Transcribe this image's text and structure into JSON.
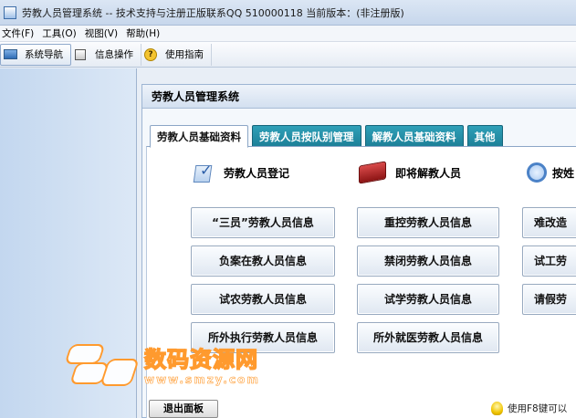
{
  "window": {
    "title": "劳教人员管理系统 -- 技术支持与注册正版联系QQ 510000118    当前版本：(非注册版)"
  },
  "menu": {
    "items": [
      "文件(F)",
      "工具(O)",
      "视图(V)",
      "帮助(H)"
    ]
  },
  "toolbar": {
    "items": [
      {
        "label": "系统导航",
        "icon": "monitor-icon"
      },
      {
        "label": "信息操作",
        "icon": "box-icon"
      },
      {
        "label": "使用指南",
        "icon": "help-icon"
      }
    ]
  },
  "panel": {
    "title": "劳教人员管理系统",
    "tabs": [
      "劳教人员基础资料",
      "劳教人员按队别管理",
      "解教人员基础资料",
      "其他"
    ],
    "active_tab": "劳教人员基础资料",
    "sections": [
      {
        "label": "劳教人员登记",
        "icon": "checklist-icon"
      },
      {
        "label": "即将解教人员",
        "icon": "folder-icon"
      },
      {
        "label": "按姓",
        "icon": "search-icon"
      }
    ],
    "buttons": {
      "col1": [
        "“三员”劳教人员信息",
        "负案在教人员信息",
        "试农劳教人员信息",
        "所外执行劳教人员信息"
      ],
      "col2": [
        "重控劳教人员信息",
        "禁闭劳教人员信息",
        "试学劳教人员信息",
        "所外就医劳教人员信息"
      ],
      "col3": [
        "难改造",
        "试工劳",
        "请假劳"
      ]
    },
    "exit_label": "退出面板",
    "hint": "使用F8键可以"
  },
  "watermark": {
    "cn": "数码资源网",
    "url": "www.smzy.com"
  },
  "colors": {
    "tab_active_bg": "#ffffff",
    "tab_inactive_bg": "#2fa0b8",
    "sidebar_bg": "#c3d7ef",
    "watermark_orange": "#ff9a2e"
  }
}
